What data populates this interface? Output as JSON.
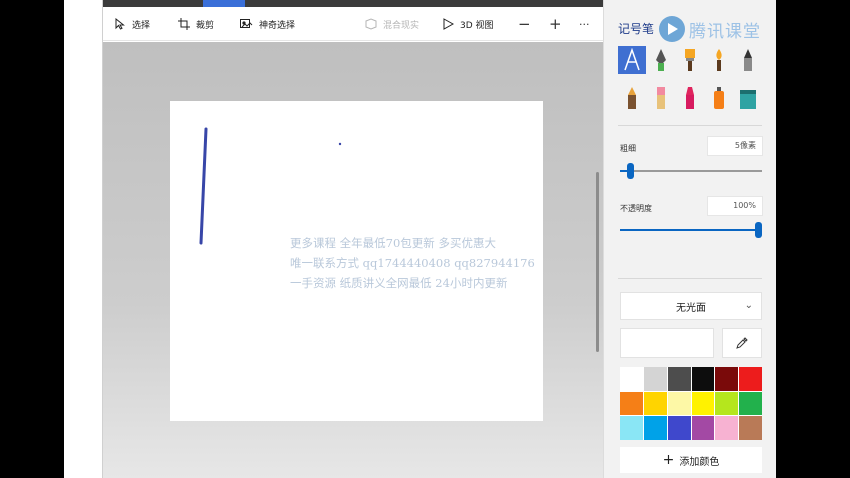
{
  "toolbar": {
    "select_label": "选择",
    "crop_label": "裁剪",
    "magic_select_label": "神奇选择",
    "paste_label": "混合现实",
    "view3d_label": "3D 视图",
    "zoom_out": "−",
    "zoom_in": "+",
    "more": "···"
  },
  "watermark": {
    "line1": "更多课程    全年最低70包更新    多买优惠大",
    "line2": "唯一联系方式   qq1744440408    qq827944176",
    "line3": "一手资源  纸质讲义全网最低   24小时内更新"
  },
  "panel": {
    "title": "记号笔",
    "brand_text": "腾讯课堂",
    "thickness_label": "粗细",
    "thickness_value": "5像素",
    "thickness_fraction": 0.05,
    "opacity_label": "不透明度",
    "opacity_value": "100%",
    "opacity_fraction": 1.0,
    "finish": "无光面",
    "add_color_label": "添加颜色",
    "accent_color": "#0a66c2",
    "palette": [
      "#ffffff",
      "#d4d4d4",
      "#4d4d4d",
      "#0d0d0d",
      "#7a0a0a",
      "#ed1c1c",
      "#f57f17",
      "#ffd400",
      "#fdf8a6",
      "#fff200",
      "#b5e61d",
      "#22b14c",
      "#8ae6f5",
      "#00a2e8",
      "#3f48cc",
      "#a349a4",
      "#f7b2d2",
      "#b97a57"
    ],
    "tools": [
      "calligraphy-pen-icon",
      "ink-pen-icon",
      "oil-brush-icon",
      "watercolor-icon",
      "pencil-icon",
      "crayon-icon",
      "eraser-icon",
      "marker-icon",
      "spray-can-icon",
      "fill-bucket-icon"
    ]
  }
}
